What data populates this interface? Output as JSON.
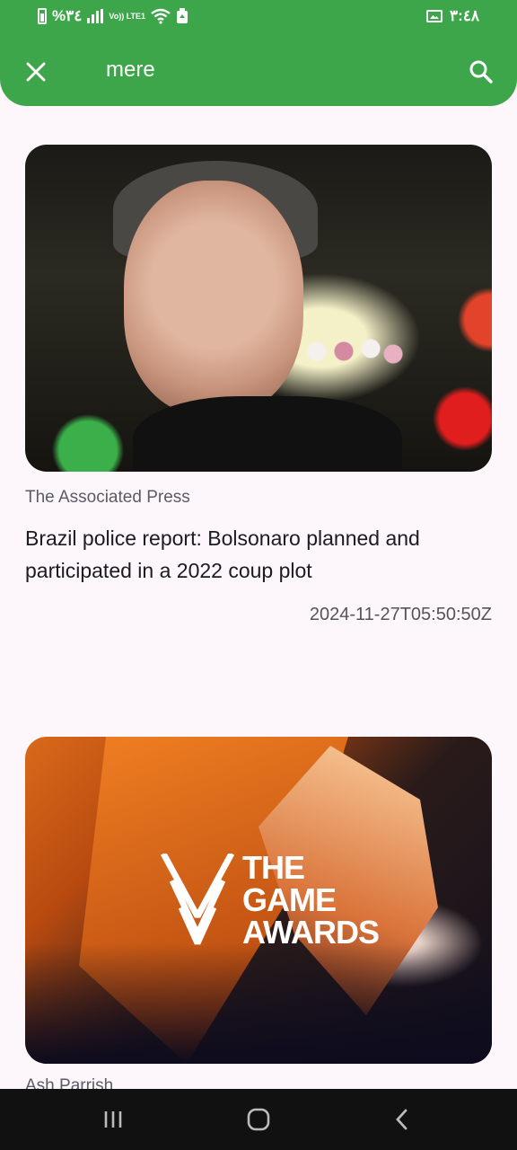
{
  "status_bar": {
    "battery_percent": "%٣٤",
    "lte_tag": "Vo)) LTE1",
    "time": "٣:٤٨"
  },
  "app_bar": {
    "search_query": "mere",
    "close_icon": "close-icon",
    "search_icon": "search-icon",
    "color": "#3ea64a"
  },
  "articles": [
    {
      "source": "The Associated Press",
      "title": "Brazil police report: Bolsonaro planned and participated in a 2022 coup plot",
      "published": "2024-11-27T05:50:50Z"
    },
    {
      "image_text": [
        "THE",
        "GAME",
        "AWARDS"
      ],
      "source": "Ash Parrish"
    }
  ],
  "nav_bar": {
    "recents_icon": "recents-icon",
    "home_icon": "home-icon",
    "back_icon": "back-icon"
  }
}
